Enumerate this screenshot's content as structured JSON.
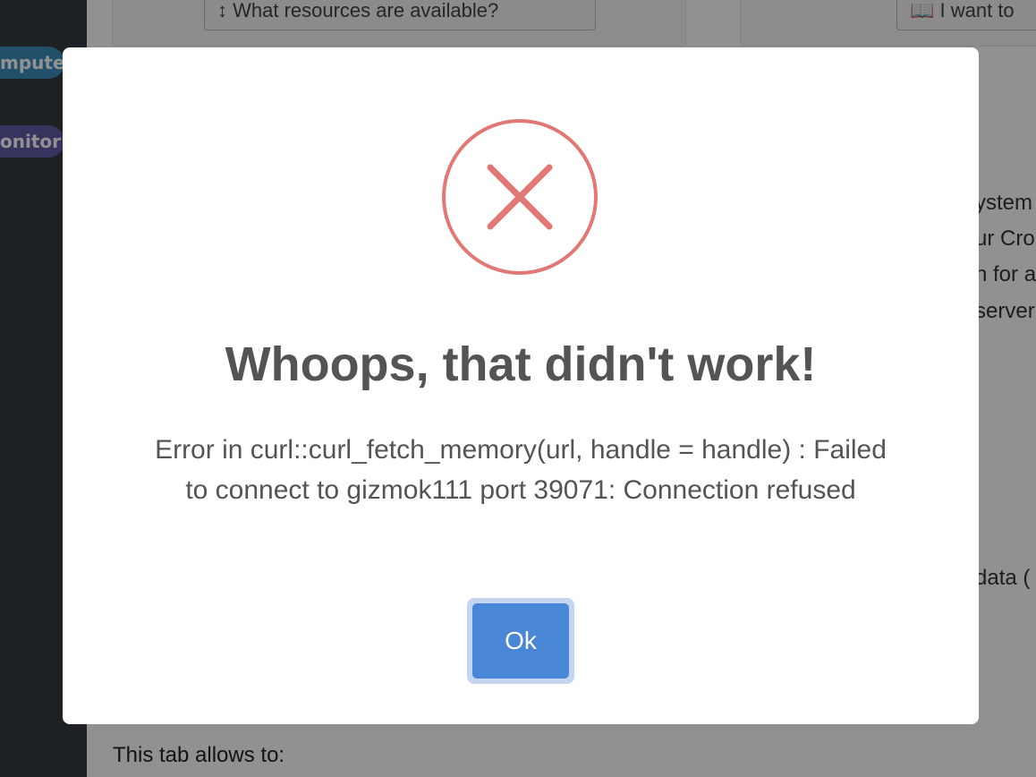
{
  "sidebar": {
    "badges": [
      {
        "label": "mpute",
        "color": "#3c8dbc"
      },
      {
        "label": "onitor",
        "color": "#605ca8"
      }
    ]
  },
  "main": {
    "card_buttons": [
      {
        "label": "↕ What resources are available?"
      },
      {
        "label": "📖 I want to"
      }
    ],
    "side_text_fragments": [
      "ystem",
      "ur Cro",
      "n for a",
      "server",
      "data ("
    ],
    "bottom_text": "This tab allows to:"
  },
  "modal": {
    "icon": "error-x-icon",
    "icon_color": "#e27875",
    "title": "Whoops, that didn't work!",
    "message": "Error in curl::curl_fetch_memory(url, handle = handle) : Failed to connect to gizmok111 port 39071: Connection refused",
    "ok_label": "Ok",
    "ok_color": "#4a86d6"
  }
}
